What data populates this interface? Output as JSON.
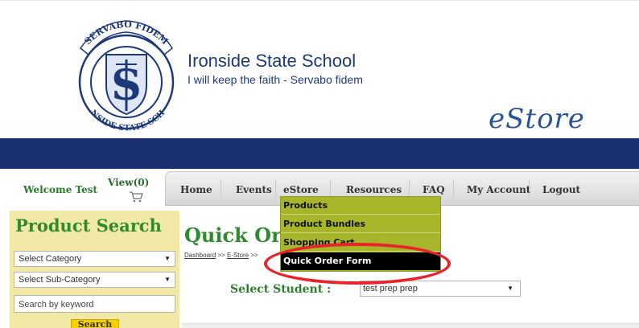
{
  "header": {
    "crest_text_top": "SERVABO FIDEM",
    "crest_text_bottom": "IRONSIDE STATE SCHOOL",
    "school_name": "Ironside State School",
    "motto": "I will keep the faith - Servabo fidem",
    "store_logo": "eStore"
  },
  "colors": {
    "brand_blue": "#1b3070",
    "title_green": "#2e8b2e",
    "dropdown_olive": "#a7b52b",
    "sidebar_cream": "#f2e9a6",
    "search_yellow": "#f5d100",
    "highlight_red": "#e8232a"
  },
  "user": {
    "welcome": "Welcome Test",
    "cart_label": "View(0)",
    "cart_icon": "shopping-cart-icon"
  },
  "nav": {
    "items": [
      "Home",
      "Events",
      "eStore",
      "Resources",
      "FAQ",
      "My Account",
      "Logout"
    ]
  },
  "estore_menu": {
    "items": [
      "Products",
      "Product Bundles",
      "Shopping Cart",
      "Quick Order Form"
    ],
    "active": "Quick Order Form"
  },
  "sidebar": {
    "title": "Product Search",
    "category": "Select Category",
    "subcategory": "Select Sub-Category",
    "keyword_placeholder": "Search by keyword",
    "search_button": "Search"
  },
  "main": {
    "title": "Quick Order Form",
    "breadcrumb": [
      "Dashboard",
      ">>",
      "E-Store",
      ">>"
    ],
    "student_label": "Select Student :",
    "student_value": "test prep prep"
  }
}
